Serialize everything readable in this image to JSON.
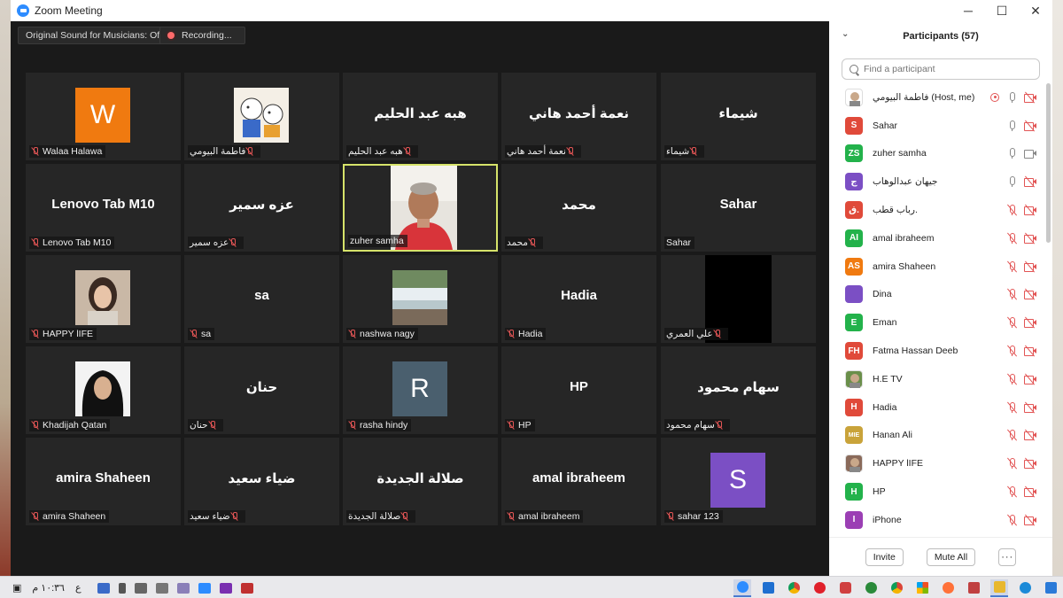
{
  "window": {
    "title": "Zoom Meeting",
    "minimize": "─",
    "maximize": "☐",
    "close": "✕"
  },
  "top_bar": {
    "original_sound": "Original Sound for Musicians: Off",
    "recording": "Recording..."
  },
  "tiles": [
    {
      "caption": "Walaa Halawa",
      "big": "",
      "avatar": "W",
      "avatar_color": "#f07a10",
      "caption_rtl": false
    },
    {
      "caption": "فاطمة البيومي",
      "big": "",
      "picture": "cartoon",
      "caption_rtl": true
    },
    {
      "caption": "هبه عبد الحليم",
      "big": "هبه عبد الحليم",
      "caption_rtl": true
    },
    {
      "caption": "نعمة أحمد هاني",
      "big": "نعمة أحمد هاني",
      "caption_rtl": true
    },
    {
      "caption": "شيماء",
      "big": "شيماء",
      "caption_rtl": true
    },
    {
      "caption": "Lenovo Tab M10",
      "big": "Lenovo Tab M10",
      "caption_rtl": false
    },
    {
      "caption": "عزه سمير",
      "big": "عزه سمير",
      "caption_rtl": true
    },
    {
      "caption": "zuher samha",
      "big": "",
      "picture": "video",
      "active": true,
      "caption_rtl": false,
      "mic_on": true
    },
    {
      "caption": "محمد",
      "big": "محمد",
      "caption_rtl": true
    },
    {
      "caption": "Sahar",
      "big": "Sahar",
      "caption_rtl": false,
      "mic_on": true
    },
    {
      "caption": "HAPPY lIFE",
      "big": "",
      "picture": "portrait",
      "caption_rtl": false
    },
    {
      "caption": "sa",
      "big": "sa",
      "caption_rtl": false
    },
    {
      "caption": "nashwa nagy",
      "big": "",
      "picture": "waterfall",
      "caption_rtl": false
    },
    {
      "caption": "Hadia",
      "big": "Hadia",
      "caption_rtl": false
    },
    {
      "caption": "علي العمري",
      "big": "",
      "picture": "black",
      "caption_rtl": true
    },
    {
      "caption": "Khadijah Qatan",
      "big": "",
      "picture": "hijab",
      "caption_rtl": false
    },
    {
      "caption": "حنان",
      "big": "حنان",
      "caption_rtl": true
    },
    {
      "caption": "rasha hindy",
      "big": "",
      "avatar": "R",
      "avatar_color": "#4a5f6e",
      "caption_rtl": false
    },
    {
      "caption": "HP",
      "big": "HP",
      "caption_rtl": false
    },
    {
      "caption": "سهام محمود",
      "big": "سهام محمود",
      "caption_rtl": true
    },
    {
      "caption": "amira Shaheen",
      "big": "amira Shaheen",
      "caption_rtl": false
    },
    {
      "caption": "ضياء سعيد",
      "big": "ضياء سعيد",
      "caption_rtl": true
    },
    {
      "caption": "صلالة الجديدة",
      "big": "صلالة الجديدة",
      "caption_rtl": true
    },
    {
      "caption": "amal ibraheem",
      "big": "amal ibraheem",
      "caption_rtl": false
    },
    {
      "caption": "sahar 123",
      "big": "",
      "avatar": "S",
      "avatar_color": "#7b4fc4",
      "caption_rtl": false
    }
  ],
  "panel": {
    "title": "Participants (57)",
    "search_placeholder": "Find a participant",
    "participants": [
      {
        "name": "فاطمة البيومي (Host, me)",
        "initials": "",
        "color": "#ffffff",
        "picture": true,
        "mic": "on",
        "cam": "off",
        "share": true
      },
      {
        "name": "Sahar",
        "initials": "S",
        "color": "#e04a3a",
        "mic": "on",
        "cam": "off"
      },
      {
        "name": "zuher samha",
        "initials": "ZS",
        "color": "#23b24b",
        "mic": "on",
        "cam": "on"
      },
      {
        "name": "جيهان عبدالوهاب",
        "initials": "ج",
        "color": "#7b4fc4",
        "mic": "on",
        "cam": "off"
      },
      {
        "name": "رباب قطب.",
        "initials": "ق.",
        "color": "#e04a3a",
        "mic": "off",
        "cam": "off"
      },
      {
        "name": "amal ibraheem",
        "initials": "AI",
        "color": "#23b24b",
        "mic": "off",
        "cam": "off"
      },
      {
        "name": "amira Shaheen",
        "initials": "AS",
        "color": "#f07a10",
        "mic": "off",
        "cam": "off"
      },
      {
        "name": "Dina",
        "initials": "",
        "color": "#7b4fc4",
        "mic": "off",
        "cam": "off"
      },
      {
        "name": "Eman",
        "initials": "E",
        "color": "#23b24b",
        "mic": "off",
        "cam": "off"
      },
      {
        "name": "Fatma Hassan Deeb",
        "initials": "FH",
        "color": "#e04a3a",
        "mic": "off",
        "cam": "off"
      },
      {
        "name": "H.E TV",
        "initials": "",
        "color": "#6a8f4a",
        "picture": true,
        "mic": "off",
        "cam": "off"
      },
      {
        "name": "Hadia",
        "initials": "H",
        "color": "#e04a3a",
        "mic": "off",
        "cam": "off"
      },
      {
        "name": "Hanan Ali",
        "initials": "MIE",
        "color": "#c9a33a",
        "mic": "off",
        "cam": "off"
      },
      {
        "name": "HAPPY lIFE",
        "initials": "",
        "color": "#8a6a5a",
        "picture": true,
        "mic": "off",
        "cam": "off"
      },
      {
        "name": "HP",
        "initials": "H",
        "color": "#23b24b",
        "mic": "off",
        "cam": "off"
      },
      {
        "name": "iPhone",
        "initials": "I",
        "color": "#9b3fb4",
        "mic": "off",
        "cam": "off"
      }
    ],
    "invite": "Invite",
    "mute_all": "Mute All",
    "more": "···"
  },
  "taskbar": {
    "clock": "١٠:٣٦ م",
    "lang": "ع"
  }
}
